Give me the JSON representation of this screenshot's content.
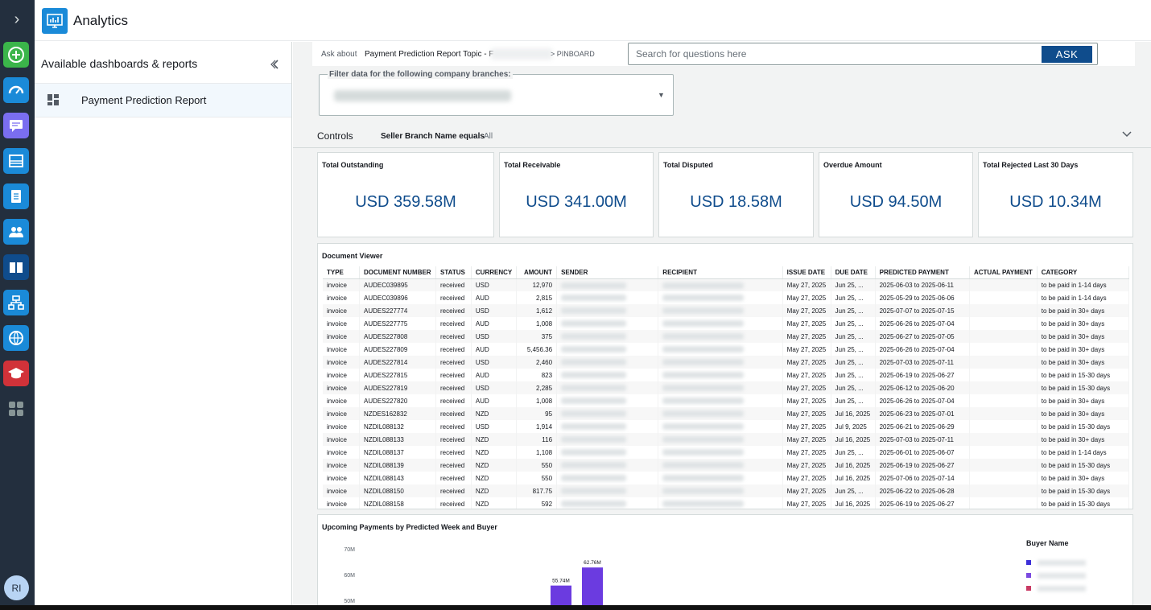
{
  "colors": {
    "rail_bg": "#232f3e",
    "accent": "#0f4c8c",
    "bar_primary": "#6b3be0",
    "legend": [
      "#3d2fd8",
      "#7b4ae0",
      "#c93a64"
    ]
  },
  "rail": {
    "expand_icon": "chevron-right-icon",
    "icons": [
      "add-icon",
      "dashboard-gauge-icon",
      "chat-icon",
      "inbox-icon",
      "clipboard-icon",
      "users-icon",
      "book-icon",
      "hierarchy-icon",
      "globe-icon",
      "graduation-cap-icon",
      "apps-grid-icon"
    ],
    "avatar": "RI"
  },
  "header": {
    "title": "Analytics",
    "logo_icon": "analytics-monitor-icon"
  },
  "panel": {
    "title": "Available dashboards & reports",
    "collapse_icon": "collapse-icon",
    "items": [
      {
        "label": "Payment Prediction Report",
        "icon": "dashboard-grid-icon"
      }
    ]
  },
  "ask": {
    "ask_about": "Ask about",
    "topic": "Payment Prediction Report Topic - F",
    "pinboard": "> PINBOARD",
    "placeholder": "Search for questions here",
    "button": "ASK"
  },
  "filter": {
    "legend": "Filter data for the following company branches:"
  },
  "controls": {
    "label": "Controls",
    "condition": "Seller Branch Name equals",
    "value": "All"
  },
  "kpis": [
    {
      "title": "Total Outstanding",
      "value": "USD 359.58M"
    },
    {
      "title": "Total Receivable",
      "value": "USD 341.00M"
    },
    {
      "title": "Total Disputed",
      "value": "USD 18.58M"
    },
    {
      "title": "Overdue Amount",
      "value": "USD 94.50M"
    },
    {
      "title": "Total Rejected Last 30 Days",
      "value": "USD 10.34M"
    }
  ],
  "document_viewer": {
    "title": "Document Viewer",
    "columns": [
      "TYPE",
      "DOCUMENT NUMBER",
      "STATUS",
      "CURRENCY",
      "AMOUNT",
      "SENDER",
      "RECIPIENT",
      "ISSUE DATE",
      "DUE DATE",
      "PREDICTED PAYMENT",
      "ACTUAL PAYMENT",
      "CATEGORY"
    ],
    "rows": [
      [
        "invoice",
        "AUDEC039895",
        "received",
        "USD",
        "12,970",
        "May 27, 2025",
        "Jun 25, ...",
        "2025-06-03 to 2025-06-11",
        "to be paid in 1-14 days"
      ],
      [
        "invoice",
        "AUDEC039896",
        "received",
        "AUD",
        "2,815",
        "May 27, 2025",
        "Jun 25, ...",
        "2025-05-29 to 2025-06-06",
        "to be paid in 1-14 days"
      ],
      [
        "invoice",
        "AUDES227774",
        "received",
        "USD",
        "1,612",
        "May 27, 2025",
        "Jun 25, ...",
        "2025-07-07 to 2025-07-15",
        "to be paid in 30+ days"
      ],
      [
        "invoice",
        "AUDES227775",
        "received",
        "AUD",
        "1,008",
        "May 27, 2025",
        "Jun 25, ...",
        "2025-06-26 to 2025-07-04",
        "to be paid in 30+ days"
      ],
      [
        "invoice",
        "AUDES227808",
        "received",
        "USD",
        "375",
        "May 27, 2025",
        "Jun 25, ...",
        "2025-06-27 to 2025-07-05",
        "to be paid in 30+ days"
      ],
      [
        "invoice",
        "AUDES227809",
        "received",
        "AUD",
        "5,456.36",
        "May 27, 2025",
        "Jun 25, ...",
        "2025-06-26 to 2025-07-04",
        "to be paid in 30+ days"
      ],
      [
        "invoice",
        "AUDES227814",
        "received",
        "USD",
        "2,460",
        "May 27, 2025",
        "Jun 25, ...",
        "2025-07-03 to 2025-07-11",
        "to be paid in 30+ days"
      ],
      [
        "invoice",
        "AUDES227815",
        "received",
        "AUD",
        "823",
        "May 27, 2025",
        "Jun 25, ...",
        "2025-06-19 to 2025-06-27",
        "to be paid in 15-30 days"
      ],
      [
        "invoice",
        "AUDES227819",
        "received",
        "USD",
        "2,285",
        "May 27, 2025",
        "Jun 25, ...",
        "2025-06-12 to 2025-06-20",
        "to be paid in 15-30 days"
      ],
      [
        "invoice",
        "AUDES227820",
        "received",
        "AUD",
        "1,008",
        "May 27, 2025",
        "Jun 25, ...",
        "2025-06-26 to 2025-07-04",
        "to be paid in 30+ days"
      ],
      [
        "invoice",
        "NZDES162832",
        "received",
        "NZD",
        "95",
        "May 27, 2025",
        "Jul 16, 2025",
        "2025-06-23 to 2025-07-01",
        "to be paid in 30+ days"
      ],
      [
        "invoice",
        "NZDIL088132",
        "received",
        "USD",
        "1,914",
        "May 27, 2025",
        "Jul 9, 2025",
        "2025-06-21 to 2025-06-29",
        "to be paid in 15-30 days"
      ],
      [
        "invoice",
        "NZDIL088133",
        "received",
        "NZD",
        "116",
        "May 27, 2025",
        "Jul 16, 2025",
        "2025-07-03 to 2025-07-11",
        "to be paid in 30+ days"
      ],
      [
        "invoice",
        "NZDIL088137",
        "received",
        "NZD",
        "1,108",
        "May 27, 2025",
        "Jun 25, ...",
        "2025-06-01 to 2025-06-07",
        "to be paid in 1-14 days"
      ],
      [
        "invoice",
        "NZDIL088139",
        "received",
        "NZD",
        "550",
        "May 27, 2025",
        "Jul 16, 2025",
        "2025-06-19 to 2025-06-27",
        "to be paid in 15-30 days"
      ],
      [
        "invoice",
        "NZDIL088143",
        "received",
        "NZD",
        "550",
        "May 27, 2025",
        "Jul 16, 2025",
        "2025-07-06 to 2025-07-14",
        "to be paid in 30+ days"
      ],
      [
        "invoice",
        "NZDIL088150",
        "received",
        "NZD",
        "817.75",
        "May 27, 2025",
        "Jun 25, ...",
        "2025-06-22 to 2025-06-28",
        "to be paid in 15-30 days"
      ],
      [
        "invoice",
        "NZDIL088158",
        "received",
        "NZD",
        "592",
        "May 27, 2025",
        "Jul 16, 2025",
        "2025-06-19 to 2025-06-27",
        "to be paid in 15-30 days"
      ]
    ]
  },
  "chart_data": {
    "type": "bar",
    "title": "Upcoming Payments by Predicted Week and Buyer",
    "legend_title": "Buyer Name",
    "legend_placement": "right",
    "y_ticks": [
      "70M",
      "60M",
      "50M"
    ],
    "ylim_visible": [
      50,
      70
    ],
    "bars": [
      {
        "value": 55.74,
        "label": "55.74M"
      },
      {
        "value": 62.76,
        "label": "62.76M"
      }
    ]
  }
}
